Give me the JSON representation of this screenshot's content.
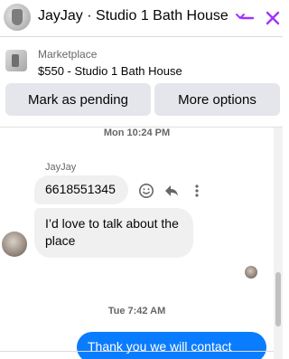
{
  "header": {
    "title": "JayJay · Studio 1 Bath House",
    "accent_color": "#a033ff"
  },
  "listing": {
    "kicker": "Marketplace",
    "subject": "$550 - Studio 1 Bath House"
  },
  "actions": {
    "mark_pending_label": "Mark as pending",
    "more_options_label": "More options"
  },
  "thread": {
    "timestamp_1": "Mon 10:24 PM",
    "sender_name": "JayJay",
    "message_1": "6618551345",
    "message_2": "I’d love to talk about the place",
    "timestamp_2": "Tue 7:42 AM",
    "message_3": "Thank you we will contact"
  },
  "icons": {
    "chevron": "chevron-down-icon",
    "minimize": "minimize-icon",
    "close": "close-icon",
    "react": "smiley-icon",
    "reply": "reply-icon",
    "more": "more-vertical-icon"
  },
  "colors": {
    "outgoing_bubble": "#0a7cff",
    "incoming_bubble": "#f0f0f0",
    "button_bg": "#e4e6eb"
  }
}
